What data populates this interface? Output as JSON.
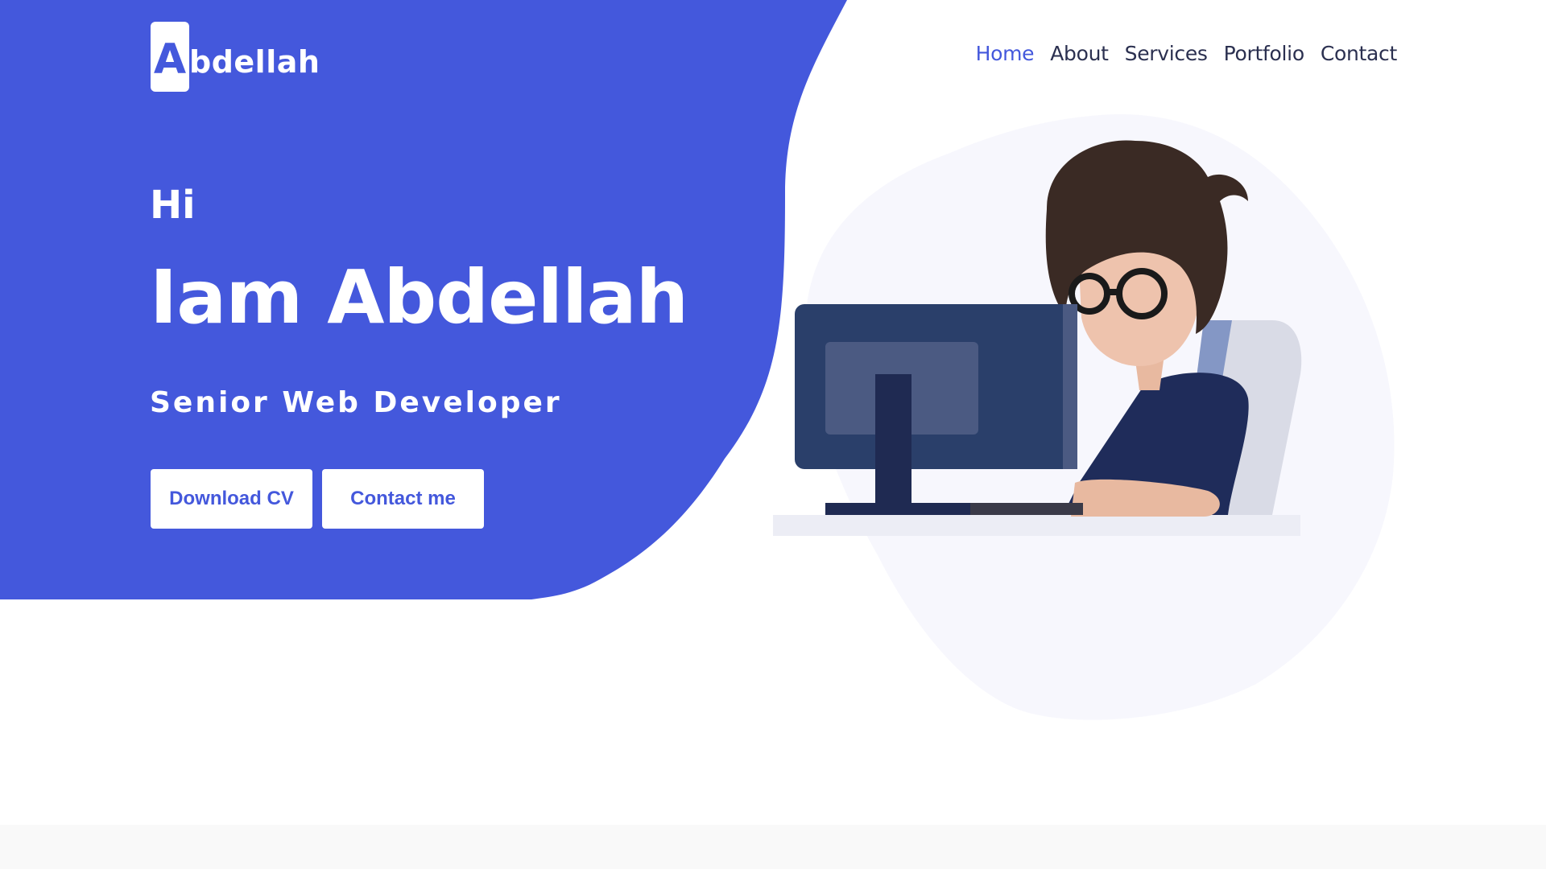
{
  "brand": {
    "logo_letter": "A",
    "logo_rest": "bdellah"
  },
  "nav": {
    "items": [
      "Home",
      "About",
      "Services",
      "Portfolio",
      "Contact"
    ],
    "active": "Home"
  },
  "hero": {
    "greeting": "Hi",
    "headline": "Iam Abdellah",
    "role": "Senior Web Developer",
    "buttons": {
      "download_cv": "Download CV",
      "contact_me": "Contact me"
    },
    "illustration": "developer-at-computer"
  },
  "colors": {
    "accent": "#4458dc",
    "nav_text": "#2b3050",
    "blob_light": "#f7f7fd",
    "hair": "#3a2a24",
    "monitor": "#2a3f6a",
    "shirt": "#1f2c5a",
    "chair": "#d9dbe6",
    "desk": "#ecedf5"
  }
}
